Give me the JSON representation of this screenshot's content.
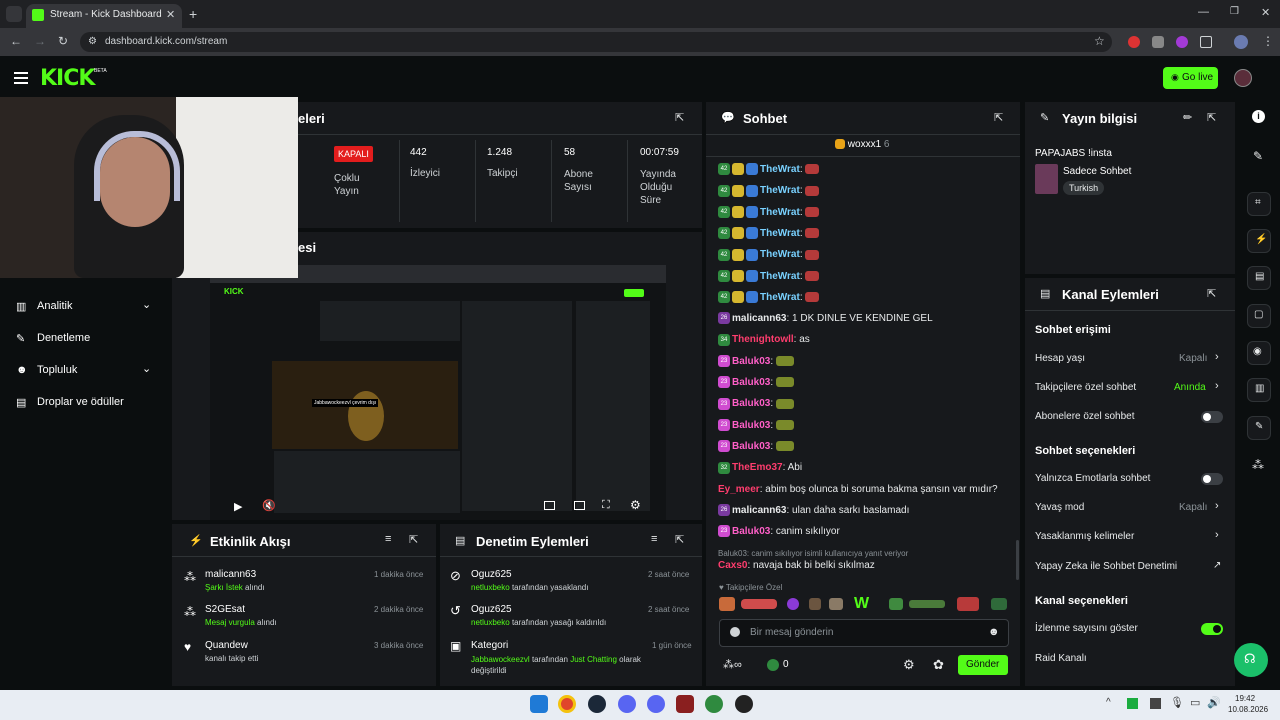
{
  "browser": {
    "tab_title": "Stream - Kick Dashboard",
    "url": "dashboard.kick.com/stream"
  },
  "header": {
    "logo": "KICK",
    "logo_badge": "BETA",
    "go_live": "Go live"
  },
  "stats": {
    "panel_title_partial": "eleri",
    "items": [
      {
        "value": "KAPALI",
        "label": "Çoklu Yayın"
      },
      {
        "value": "442",
        "label": "İzleyici"
      },
      {
        "value": "1.248",
        "label": "Takipçi"
      },
      {
        "value": "58",
        "label": "Abone Sayısı"
      },
      {
        "value": "00:07:59",
        "label": "Yayında Olduğu Süre"
      }
    ],
    "preview_title_partial": "esi"
  },
  "preview": {
    "overlay_text": "Jabbawockeezvl çevrim dışı"
  },
  "nav": {
    "items": [
      {
        "label": "Analitik",
        "has_chevron": true
      },
      {
        "label": "Denetleme",
        "has_chevron": false
      },
      {
        "label": "Topluluk",
        "has_chevron": true
      },
      {
        "label": "Droplar ve ödüller",
        "has_chevron": false
      }
    ]
  },
  "activity": {
    "title": "Etkinlik Akışı",
    "items": [
      {
        "user": "malicann63",
        "detail": "Şarkı İstek",
        "suffix": "alındı",
        "time": "1 dakika önce"
      },
      {
        "user": "S2GEsat",
        "detail": "Mesaj vurgula",
        "suffix": "alındı",
        "time": "2 dakika önce"
      },
      {
        "user": "Quandew",
        "detail": "",
        "suffix": "kanalı takip etti",
        "time": "3 dakika önce"
      }
    ]
  },
  "moderation": {
    "title": "Denetim Eylemleri",
    "items": [
      {
        "user": "Oguz625",
        "actor": "netluxbeko",
        "text": "tarafından yasaklandı",
        "time": "2 saat önce"
      },
      {
        "user": "Oguz625",
        "actor": "netluxbeko",
        "text": "tarafından yasağı kaldırıldı",
        "time": "2 saat önce"
      },
      {
        "user": "Kategori",
        "actor": "Jabbawockeezvl",
        "text": "tarafından",
        "highlight": "Just Chatting",
        "text2": "olarak değiştirildi",
        "time": "1 gün önce"
      }
    ]
  },
  "chat": {
    "title": "Sohbet",
    "pinned_user": "woxxx1",
    "pinned_count": "6",
    "messages": [
      {
        "badge": "42",
        "user": "TheWrat",
        "color": "#79d1ff",
        "text": ""
      },
      {
        "badge": "42",
        "user": "TheWrat",
        "color": "#79d1ff",
        "text": ""
      },
      {
        "badge": "42",
        "user": "TheWrat",
        "color": "#79d1ff",
        "text": ""
      },
      {
        "badge": "42",
        "user": "TheWrat",
        "color": "#79d1ff",
        "text": ""
      },
      {
        "badge": "42",
        "user": "TheWrat",
        "color": "#79d1ff",
        "text": ""
      },
      {
        "badge": "42",
        "user": "TheWrat",
        "color": "#79d1ff",
        "text": ""
      },
      {
        "badge": "42",
        "user": "TheWrat",
        "color": "#79d1ff",
        "text": ""
      },
      {
        "badge": "26",
        "user": "malicann63",
        "color": "#e8eaeb",
        "text": "1 DK DINLE VE KENDINE GEL"
      },
      {
        "badge": "34",
        "user": "Thenightowll",
        "color": "#ff3d6e",
        "text": "as"
      },
      {
        "badge": "23",
        "user": "Baluk03",
        "color": "#ff5fc8",
        "text": ""
      },
      {
        "badge": "23",
        "user": "Baluk03",
        "color": "#ff5fc8",
        "text": ""
      },
      {
        "badge": "23",
        "user": "Baluk03",
        "color": "#ff5fc8",
        "text": ""
      },
      {
        "badge": "23",
        "user": "Baluk03",
        "color": "#ff5fc8",
        "text": ""
      },
      {
        "badge": "23",
        "user": "Baluk03",
        "color": "#ff5fc8",
        "text": ""
      },
      {
        "badge": "32",
        "user": "TheEmo37",
        "color": "#ff3d6e",
        "text": "Abi"
      },
      {
        "badge": "",
        "user": "Ey_meer",
        "color": "#ff3d6e",
        "text": "abim boş olunca bi soruma bakma şansın var mıdır?"
      },
      {
        "badge": "26",
        "user": "malicann63",
        "color": "#e8eaeb",
        "text": "ulan daha sarkı baslamadı"
      },
      {
        "badge": "23",
        "user": "Baluk03",
        "color": "#ff5fc8",
        "text": "canim sıkılıyor"
      },
      {
        "reply": "Baluk03: canim sıkılıyor isimli kullanıcıya yanıt veriyor",
        "badge": "",
        "user": "Caxs0",
        "color": "#ff3d6e",
        "text": "navaja bak bi belki sıkılmaz"
      }
    ],
    "emote_bar_label": "Takipçilere Özel",
    "input_placeholder": "Bir mesaj gönderin",
    "points": "0",
    "send": "Gönder"
  },
  "stream_info": {
    "title": "Yayın bilgisi",
    "stream_name": "PAPAJABS !insta",
    "category": "Sadece Sohbet",
    "tag": "Turkish"
  },
  "channel_actions": {
    "title": "Kanal Eylemleri",
    "chat_access_heading": "Sohbet erişimi",
    "account_age": {
      "label": "Hesap yaşı",
      "value": "Kapalı"
    },
    "followers_only": {
      "label": "Takipçilere özel sohbet",
      "value": "Anında"
    },
    "subscribers_only": {
      "label": "Abonelere özel sohbet"
    },
    "chat_options_heading": "Sohbet seçenekleri",
    "emote_only": {
      "label": "Yalnızca Emotlarla sohbet"
    },
    "slow_mode": {
      "label": "Yavaş mod",
      "value": "Kapalı"
    },
    "banned_words": {
      "label": "Yasaklanmış kelimeler"
    },
    "ai_moderation": {
      "label": "Yapay Zeka ile Sohbet Denetimi"
    },
    "channel_options_heading": "Kanal seçenekleri",
    "show_viewers": {
      "label": "İzlenme sayısını göster"
    },
    "raid": {
      "label": "Raid Kanalı"
    }
  },
  "taskbar": {
    "time": "19:42",
    "date": "10.08.2026"
  },
  "colors": {
    "accent": "#53fc18",
    "panel": "#17191c",
    "bg": "#0b0e0f",
    "offline_red": "#e31d1d"
  }
}
